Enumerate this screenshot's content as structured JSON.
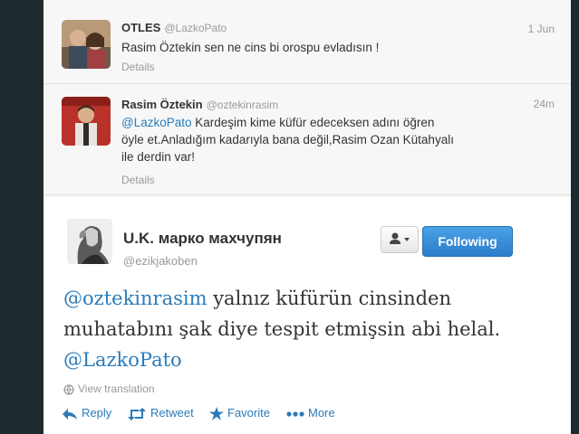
{
  "tweets": [
    {
      "name": "OTLES",
      "handle": "@LazkoPato",
      "time": "1 Jun",
      "text": "Rasim Öztekin sen ne cins bi orospu evladısın !",
      "details": "Details"
    },
    {
      "name": "Rasim Öztekin",
      "handle": "@oztekinrasim",
      "time": "24m",
      "mention": "@LazkoPato",
      "text_line1": " Kardeşim kime küfür edeceksen adını öğren",
      "text_line2": "öyle et.Anladığım kadarıyla bana değil,Rasim Ozan Kütahyalı",
      "text_line3": "ile derdin var!",
      "details": "Details"
    }
  ],
  "main_tweet": {
    "name": "U.K. марко махчупян",
    "handle": "@ezikjakoben",
    "follow_label": "Following",
    "mention1": "@oztekinrasim",
    "text_line1": " yalnız küfürün cinsinden",
    "text_line2": "muhatabını şak diye tespit etmişsin abi helal.",
    "mention2": "@LazkoPato",
    "view_translation": "View translation",
    "actions": {
      "reply": "Reply",
      "retweet": "Retweet",
      "favorite": "Favorite",
      "more": "More"
    }
  },
  "colors": {
    "link": "#2b7bb9",
    "follow_button": "#3b8fd6",
    "background": "#1f2a2f"
  }
}
